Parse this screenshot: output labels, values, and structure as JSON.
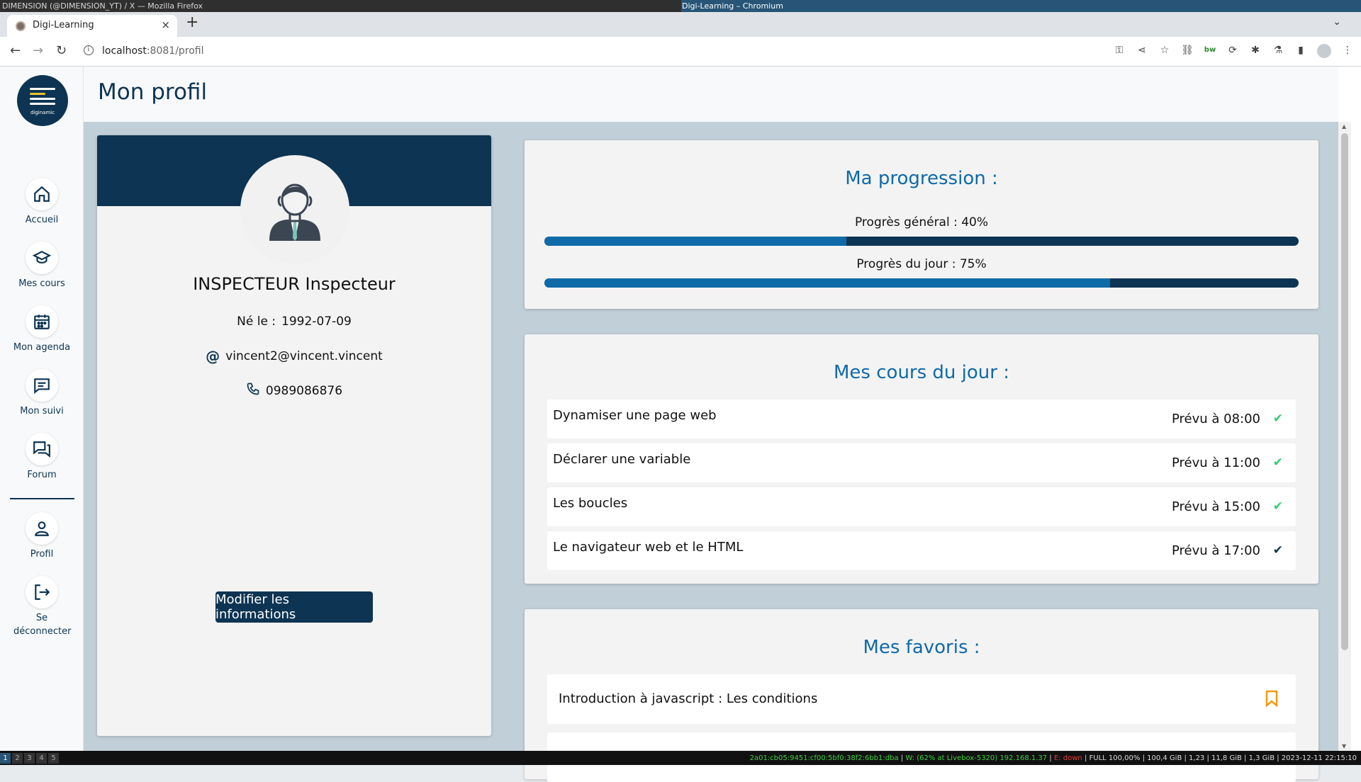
{
  "system": {
    "left_title": "DIMENSION (@DIMENSION_YT) / X — Mozilla Firefox",
    "window_title": "Digi-Learning – Chromium",
    "workspaces": [
      "1",
      "2",
      "3",
      "4",
      "5"
    ],
    "status_ip": "2a01:cb05:9451:cf00:5bf0:38f2:6bb1:dba",
    "status_wifi": "W: (62% at Livebox-5320) 192.168.1.37",
    "status_eth": "E: down",
    "status_rest": "FULL 100,00% | 100,4 GiB | 1,23 | 11,8 GiB | 1,3 GiB | 2023-12-11 22:15:10"
  },
  "browser": {
    "tab_title": "Digi-Learning",
    "tab_close": "×",
    "new_tab": "+",
    "url_host": "localhost",
    "url_rest": ":8081/profil"
  },
  "sidebar": {
    "brand": "diginamic",
    "items": [
      {
        "label": "Accueil",
        "icon": "home-icon"
      },
      {
        "label": "Mes cours",
        "icon": "graduation-cap-icon"
      },
      {
        "label": "Mon agenda",
        "icon": "calendar-icon"
      },
      {
        "label": "Mon suivi",
        "icon": "message-icon"
      },
      {
        "label": "Forum",
        "icon": "forum-icon"
      },
      {
        "label": "Profil",
        "icon": "user-icon"
      },
      {
        "label": "Se déconnecter",
        "icon": "logout-icon"
      }
    ]
  },
  "page": {
    "title": "Mon profil"
  },
  "profile": {
    "name": "INSPECTEUR Inspecteur",
    "birth_label": "Né le :",
    "birth_value": "1992-07-09",
    "email": "vincent2@vincent.vincent",
    "phone": "0989086876",
    "edit_button": "Modifier les informations"
  },
  "progress": {
    "title": "Ma progression :",
    "general_label": "Progrès général : 40%",
    "general_value": 0.4,
    "daily_label": "Progrès du jour : 75%",
    "daily_value": 0.75
  },
  "courses": {
    "title": "Mes cours du jour :",
    "items": [
      {
        "title": "Dynamiser une page web",
        "time": "Prévu à 08:00",
        "check_color": "#2ecc71"
      },
      {
        "title": "Déclarer une variable",
        "time": "Prévu à 11:00",
        "check_color": "#2ecc71"
      },
      {
        "title": "Les boucles",
        "time": "Prévu à 15:00",
        "check_color": "#2ecc71"
      },
      {
        "title": "Le navigateur web et le HTML",
        "time": "Prévu à 17:00",
        "check_color": "#0d3452"
      }
    ]
  },
  "favorites": {
    "title": "Mes favoris :",
    "items": [
      {
        "title": "Introduction à javascript : Les conditions"
      }
    ],
    "bookmark_color": "#f39c12"
  },
  "colors": {
    "primary": "#0d3452",
    "accent": "#0f6aa8",
    "background": "#c1cfd8"
  }
}
